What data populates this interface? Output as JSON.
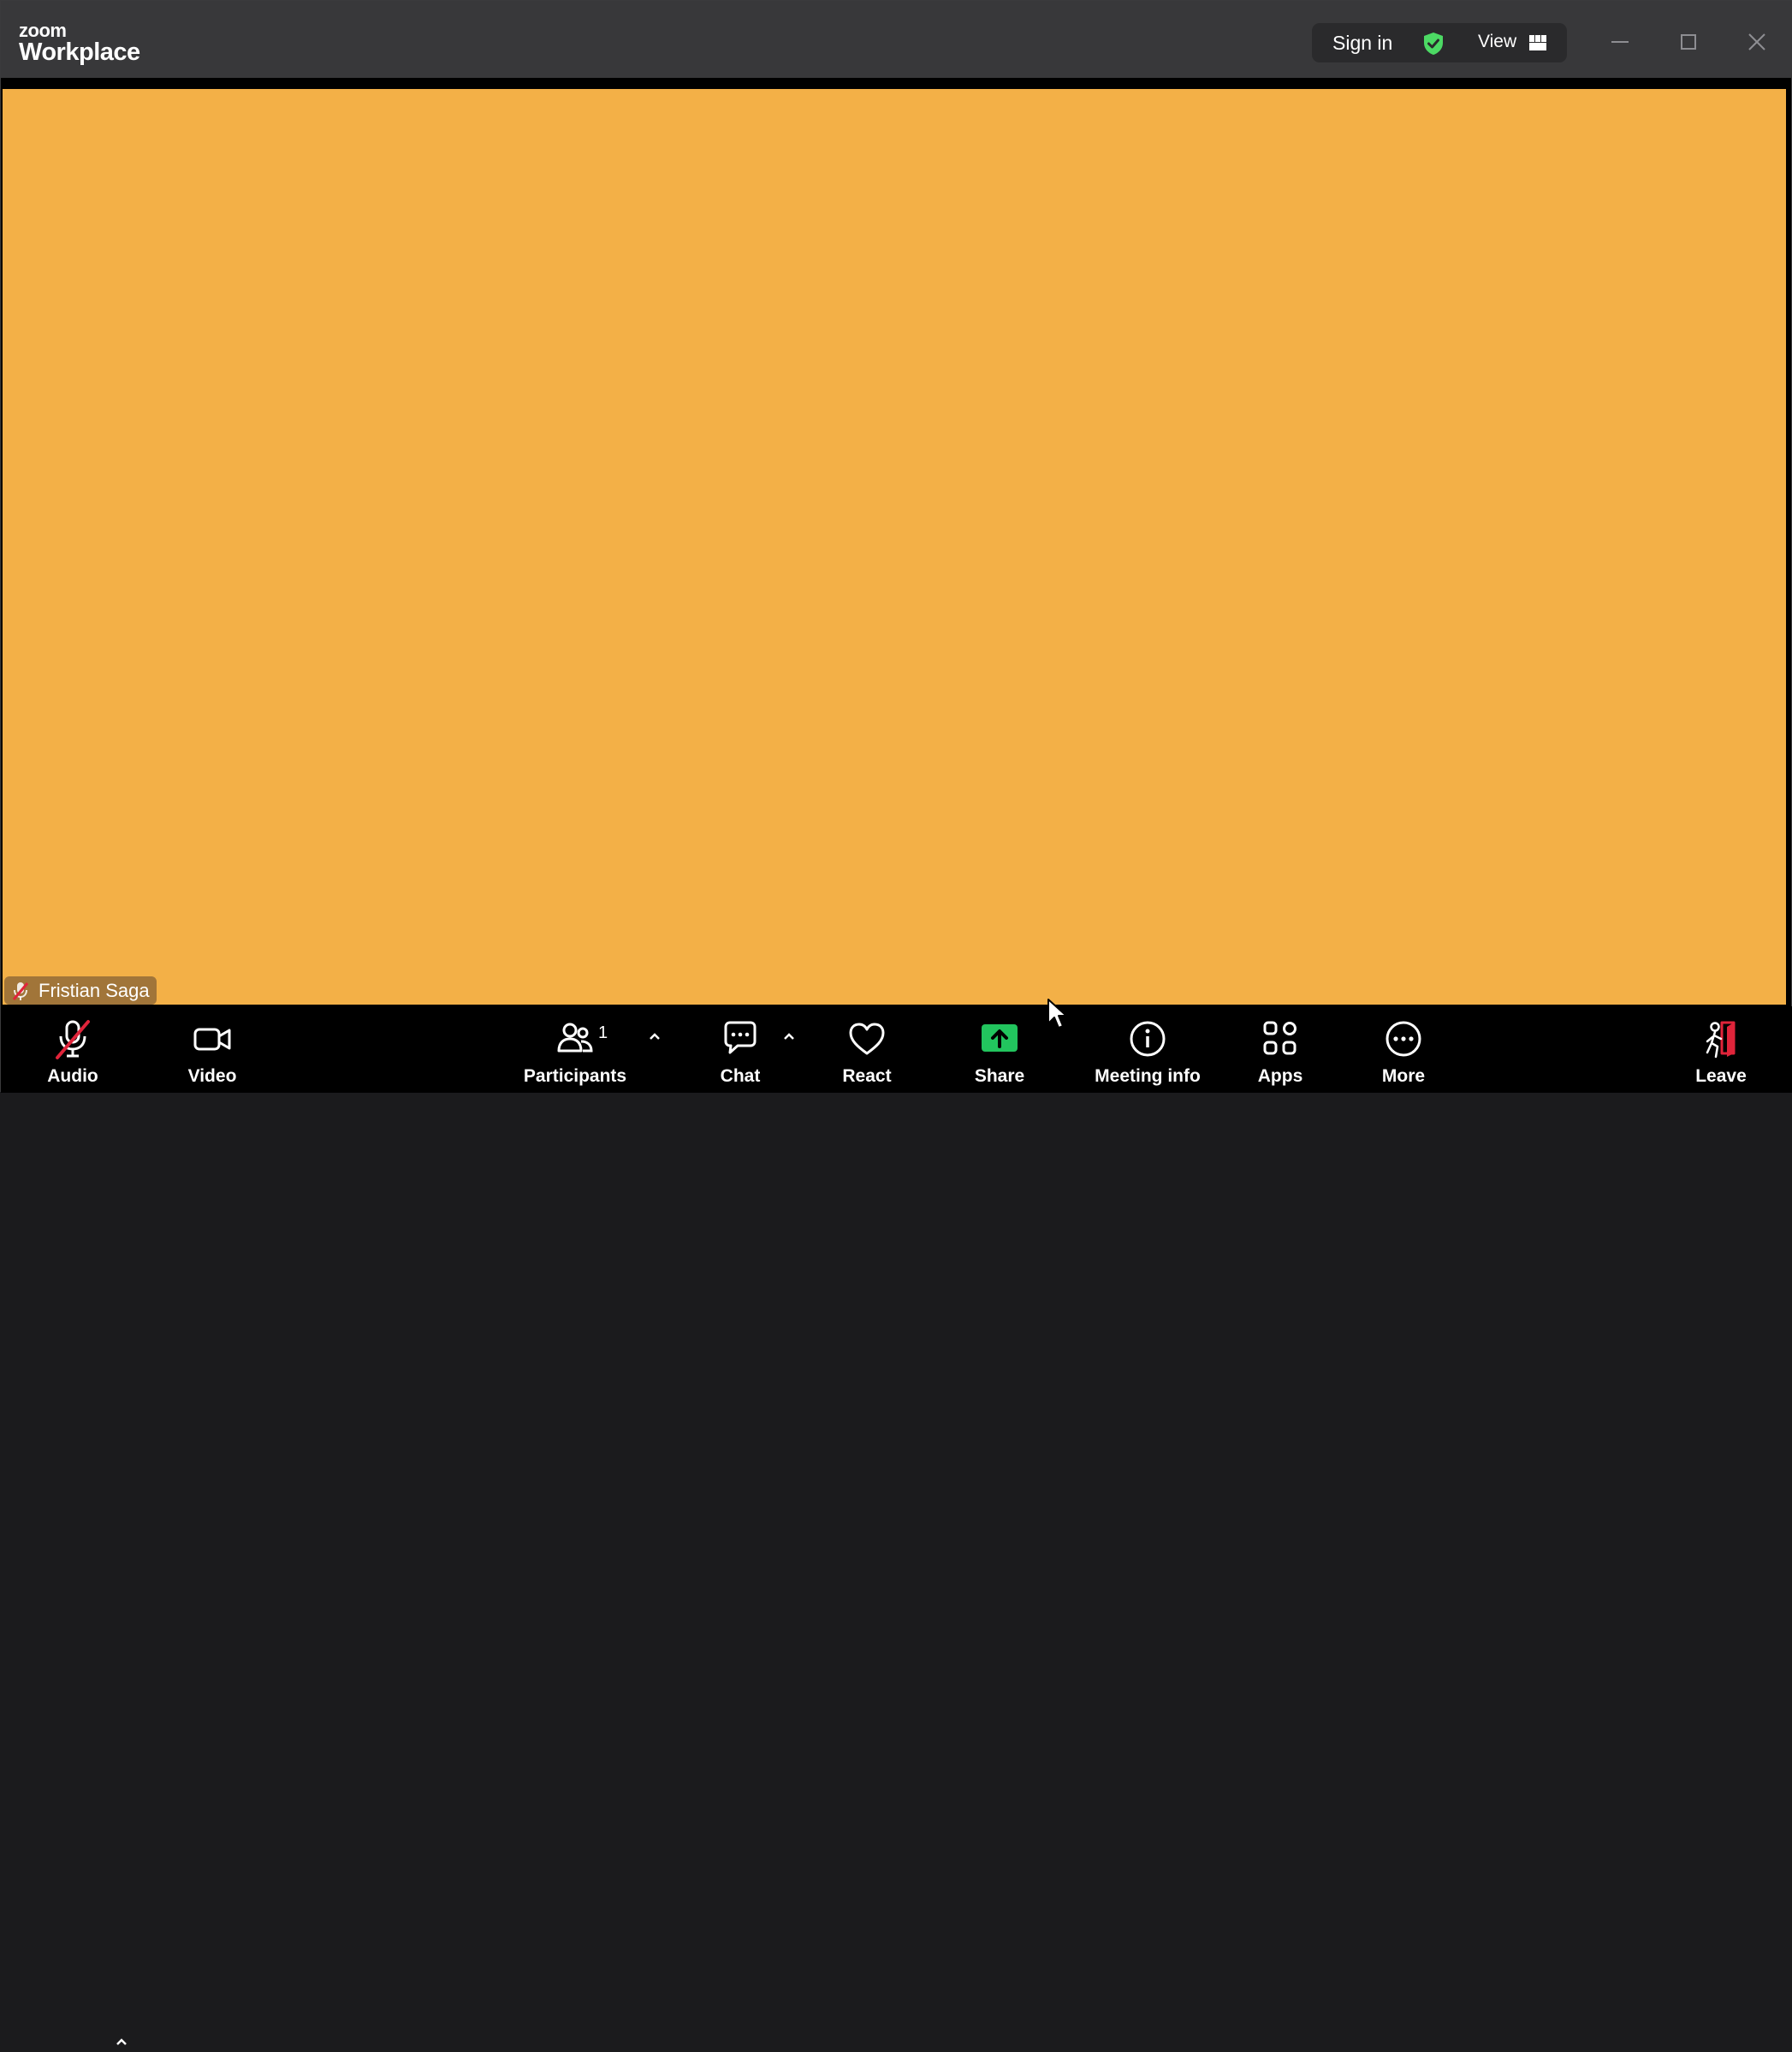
{
  "app": {
    "logo_small": "zoom",
    "logo_big": "Workplace"
  },
  "titlebar": {
    "sign_in": "Sign in",
    "view": "View",
    "shield_color": "#4cd964"
  },
  "stage": {
    "background": "#f3b047",
    "participant_name": "Fristian Saga"
  },
  "toolbar": {
    "audio": "Audio",
    "video": "Video",
    "participants": "Participants",
    "participants_count": "1",
    "chat": "Chat",
    "react": "React",
    "share": "Share",
    "meeting_info": "Meeting info",
    "apps": "Apps",
    "more": "More",
    "leave": "Leave",
    "share_color": "#22c55e",
    "leave_color": "#e0243a",
    "muted_color": "#e0243a"
  }
}
